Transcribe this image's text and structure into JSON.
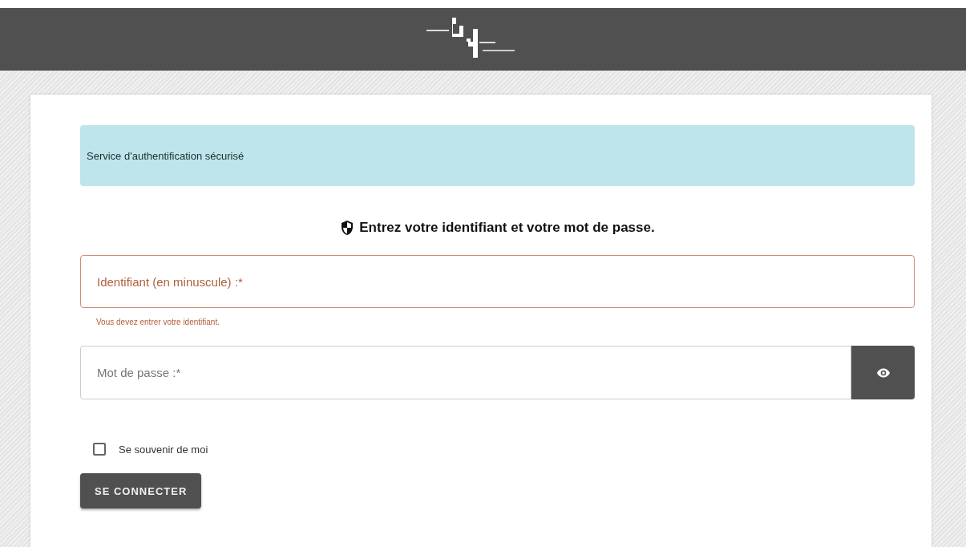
{
  "info_box": {
    "text": "Service d'authentification sécurisé"
  },
  "heading": "Entrez votre identifiant et votre mot de passe.",
  "fields": [
    {
      "kind": "text",
      "placeholder": "Identifiant (en minuscule) :*",
      "error": true,
      "error_text": "Vous devez entrer votre identifiant."
    },
    {
      "kind": "password",
      "placeholder": "Mot de passe :*",
      "error": false
    }
  ],
  "remember": {
    "label": "Se souvenir de moi",
    "checked": false
  },
  "submit": "SE CONNECTER"
}
